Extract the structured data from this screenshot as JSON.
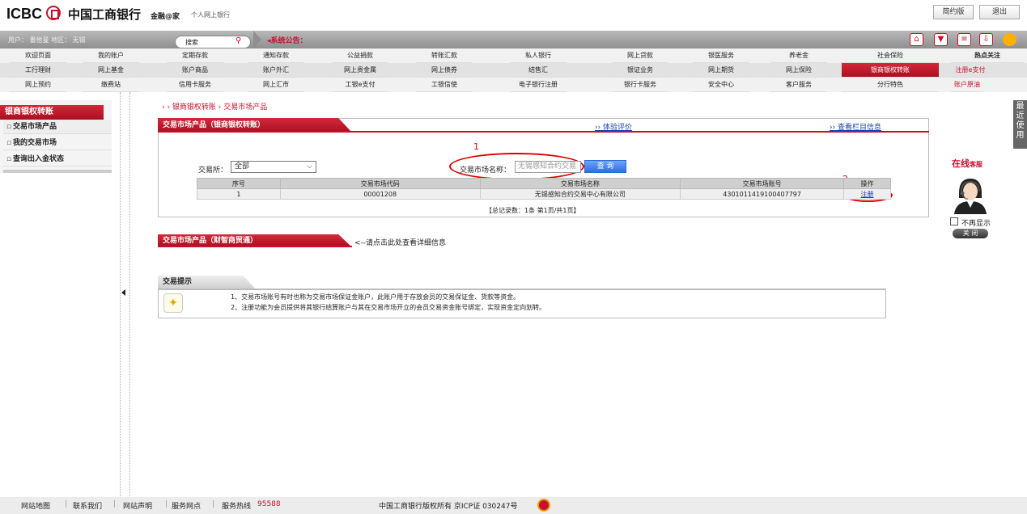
{
  "header": {
    "logo_latin": "ICBC",
    "logo_cn": "中国工商银行",
    "slogan": "金融@家",
    "subtitle": "个人网上银行",
    "btn_simple": "简约版",
    "btn_logout": "退出"
  },
  "topbar": {
    "user_info": "用户： 番他曼   地区： 无锡",
    "search_placeholder": "搜索",
    "notice": "◂系统公告：",
    "icons": [
      "home-icon",
      "cart-icon",
      "calc-icon",
      "download-icon",
      "service-icon"
    ]
  },
  "nav": {
    "row0": [
      "欢迎页面",
      "我的账户",
      "定期存款",
      "通知存款",
      "公益捐款",
      "转账汇款",
      "私人银行",
      "网上贷款",
      "银医服务",
      "养老金",
      "社会保险"
    ],
    "row1": [
      "工行理财",
      "网上基金",
      "账户商品",
      "账户外汇",
      "网上贵金属",
      "网上债券",
      "结售汇",
      "银证业务",
      "网上期货",
      "网上保险",
      "银商银权转账"
    ],
    "row2": [
      "网上预约",
      "缴费站",
      "信用卡服务",
      "网上汇市",
      "工银e支付",
      "工银信使",
      "电子银行注册",
      "银行卡服务",
      "安全中心",
      "客户服务",
      "分行特色"
    ],
    "hot_title": "热点关注",
    "hot_links": [
      "注册e支付",
      "账户原油"
    ]
  },
  "sidebar": {
    "title": "银商银权转账",
    "items": [
      "交易市场产品",
      "我的交易市场",
      "查询出入金状态"
    ]
  },
  "breadcrumb": "› › 银商银权转账 › 交易市场产品",
  "panel1": {
    "tab": "交易市场产品（银商银权转账）",
    "link_trial": "›› 体验评价",
    "link_info": "›› 查看栏目信息",
    "exchange_label": "交易所：",
    "exchange_value": "全部",
    "market_name_label": "交易市场名称：",
    "market_name_placeholder": "无锡感知合约交易",
    "query_btn": "查 询",
    "annot1": "1",
    "annot2": "2",
    "table": {
      "headers": [
        "序号",
        "交易市场代码",
        "交易市场名称",
        "交易市场账号",
        "操作"
      ],
      "rows": [
        [
          "1",
          "00001208",
          "无锡感知合约交易中心有限公司",
          "4301011419100407797",
          "注册"
        ]
      ]
    },
    "pagination": "【总记录数：1条 第1页/共1页】"
  },
  "panel2": {
    "tab": "交易市场产品（财智商贸通）",
    "hint": "<--请点击此处查看详细信息"
  },
  "tips": {
    "tab": "交易提示",
    "lines": [
      "1、交易市场账号有时也称为交易市场保证金账户，此账户用于存放会员的交易保证金、货款等资金。",
      "2、注册功能为会员提供将其银行结算账户与其在交易市场开立的会员交易资金账号绑定，实现资金定向划转。"
    ]
  },
  "chat": {
    "title_main": "在线",
    "title_sub": "客服",
    "dont_show": "不再显示",
    "close": "关 闭"
  },
  "side_tab": "最近使用",
  "footer": {
    "items": [
      "网站地图",
      "联系我们",
      "网站声明",
      "服务网点",
      "服务热线"
    ],
    "hotline": "95588",
    "copyright": "中国工商银行版权所有 京ICP证 030247号"
  },
  "colors": {
    "brand_red": "#c8102e",
    "link_blue": "#1a3fa8"
  }
}
